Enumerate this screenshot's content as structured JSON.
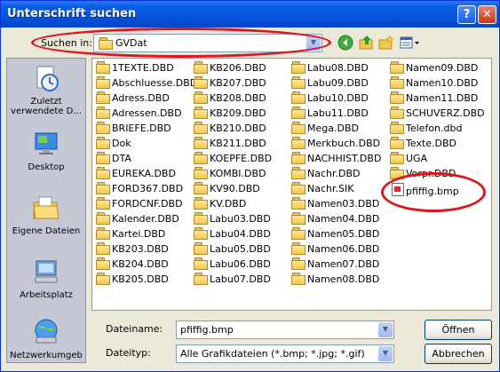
{
  "title": "Unterschrift suchen",
  "title_buttons": {
    "help": "?",
    "close": "✕"
  },
  "lookin": {
    "label": "Suchen in:",
    "value": "GVDat"
  },
  "toolbar_icons": [
    "back-icon",
    "up-folder-icon",
    "new-folder-icon",
    "views-menu-icon"
  ],
  "places": [
    {
      "label": "Zuletzt verwendete D...",
      "icon": "recent-documents-icon"
    },
    {
      "label": "Desktop",
      "icon": "desktop-icon"
    },
    {
      "label": "Eigene Dateien",
      "icon": "my-documents-icon"
    },
    {
      "label": "Arbeitsplatz",
      "icon": "my-computer-icon"
    },
    {
      "label": "Netzwerkumgeb",
      "icon": "network-places-icon"
    }
  ],
  "files": {
    "col1": [
      "1TEXTE.DBD",
      "Abschluesse.DBD",
      "Adress.DBD",
      "Adressen.DBD",
      "BRIEFE.DBD",
      "Dok",
      "DTA",
      "EUREKA.DBD",
      "FORD367.DBD",
      "FORDCNF.DBD",
      "Kalender.DBD",
      "Kartei.DBD",
      "KB203.DBD",
      "KB204.DBD",
      "KB205.DBD"
    ],
    "col2": [
      "KB206.DBD",
      "KB207.DBD",
      "KB208.DBD",
      "KB209.DBD",
      "KB210.DBD",
      "KB211.DBD",
      "KOEPFE.DBD",
      "KOMBI.DBD",
      "KV90.DBD",
      "KV.DBD",
      "Labu03.DBD",
      "Labu04.DBD",
      "Labu05.DBD",
      "Labu06.DBD",
      "Labu07.DBD"
    ],
    "col3": [
      "Labu08.DBD",
      "Labu09.DBD",
      "Labu10.DBD",
      "Labu11.DBD",
      "Mega.DBD",
      "Merkbuch.DBD",
      "NACHHIST.DBD",
      "Nachr.DBD",
      "Nachr.SIK",
      "Namen03.DBD",
      "Namen04.DBD",
      "Namen05.DBD",
      "Namen06.DBD",
      "Namen07.DBD",
      "Namen08.DBD"
    ],
    "col4": [
      "Namen09.DBD",
      "Namen10.DBD",
      "Namen11.DBD",
      "SCHUVERZ.DBD",
      "Telefon.dbd",
      "Texte.DBD",
      "UGA",
      "Vorpr.DBD"
    ],
    "bmp": "pfiffig.bmp"
  },
  "filename": {
    "label": "Dateiname:",
    "value": "pfiffig.bmp"
  },
  "filetype": {
    "label": "Dateityp:",
    "value": "Alle Grafikdateien (*.bmp; *.jpg; *.gif)"
  },
  "buttons": {
    "open": "Öffnen",
    "cancel": "Abbrechen"
  },
  "colors": {
    "titlebar": "#0453dc",
    "highlight_ellipse": "#e0141a",
    "folder": "#f2c84b"
  }
}
